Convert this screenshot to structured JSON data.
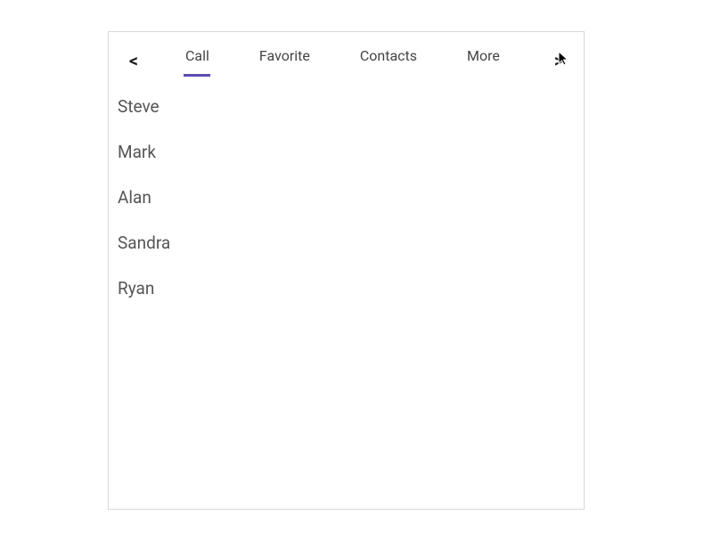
{
  "tabs": {
    "items": [
      {
        "label": "Call",
        "active": true
      },
      {
        "label": "Favorite",
        "active": false
      },
      {
        "label": "Contacts",
        "active": false
      },
      {
        "label": "More",
        "active": false
      }
    ]
  },
  "list": {
    "items": [
      {
        "name": "Steve"
      },
      {
        "name": "Mark"
      },
      {
        "name": "Alan"
      },
      {
        "name": "Sandra"
      },
      {
        "name": "Ryan"
      }
    ]
  }
}
